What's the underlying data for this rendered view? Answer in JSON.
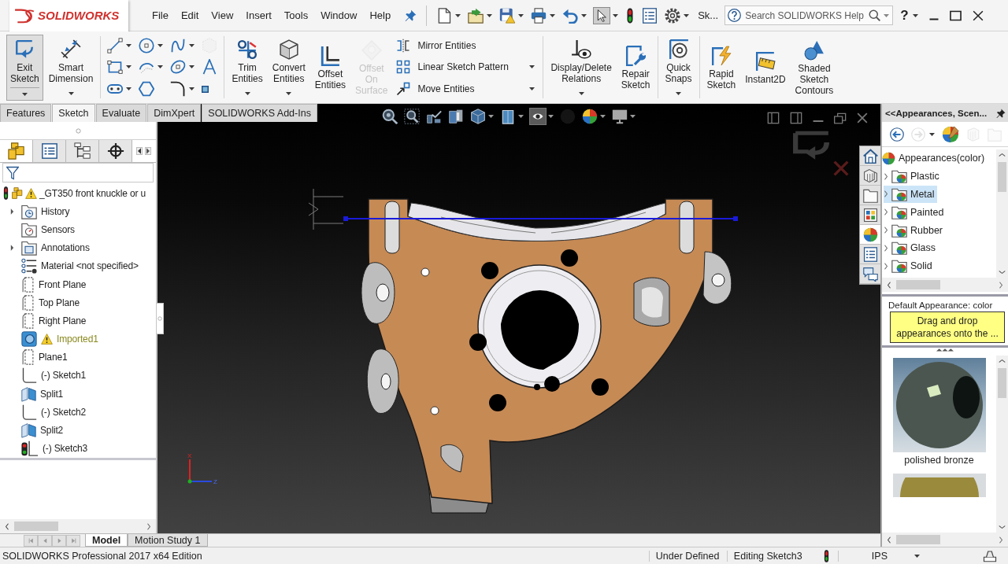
{
  "logo": {
    "text": "SOLIDWORKS"
  },
  "menu": [
    "File",
    "Edit",
    "View",
    "Insert",
    "Tools",
    "Window",
    "Help"
  ],
  "quick_access": [
    {
      "dropdown": true,
      "selected": false
    },
    {
      "dropdown": true,
      "selected": false
    },
    {
      "dropdown": true,
      "selected": false
    },
    {
      "dropdown": true,
      "selected": false
    },
    {
      "dropdown": true,
      "selected": false
    },
    {
      "dropdown": true,
      "selected": true
    },
    {
      "dropdown": false,
      "selected": false
    },
    {
      "dropdown": false,
      "selected": false
    },
    {
      "dropdown": true,
      "selected": false
    }
  ],
  "document_label": "Sk...",
  "search": {
    "placeholder": "Search SOLIDWORKS Help"
  },
  "help_button": "?",
  "ribbon": {
    "groups": [
      {
        "items": [
          {
            "kind": "button",
            "label": "Exit Sketch",
            "dropdown": true,
            "pressed": true,
            "disabled": false
          },
          {
            "kind": "button",
            "label": "Smart Dimension",
            "dropdown": true,
            "pressed": false,
            "disabled": false
          }
        ]
      },
      {
        "items": [
          {
            "kind": "tools",
            "tools": [
              {
                "dropdown": true,
                "disabled": false
              },
              {
                "dropdown": true,
                "disabled": false
              },
              {
                "dropdown": true,
                "disabled": false
              },
              {
                "dropdown": false,
                "disabled": true
              },
              {
                "dropdown": true,
                "disabled": false
              },
              {
                "dropdown": true,
                "disabled": false
              },
              {
                "dropdown": true,
                "disabled": false
              },
              {
                "dropdown": false,
                "disabled": false
              },
              {
                "dropdown": true,
                "disabled": false
              },
              {
                "dropdown": false,
                "disabled": false
              },
              {
                "dropdown": true,
                "disabled": false
              },
              {
                "dropdown": false,
                "disabled": false
              }
            ]
          }
        ]
      },
      {
        "items": [
          {
            "kind": "button",
            "label": "Trim Entities",
            "dropdown": true,
            "pressed": false,
            "disabled": false
          },
          {
            "kind": "button",
            "label": "Convert Entities",
            "dropdown": true,
            "pressed": false,
            "disabled": false
          },
          {
            "kind": "button",
            "label": "Offset Entities",
            "dropdown": false,
            "pressed": false,
            "disabled": false
          },
          {
            "kind": "button",
            "label": "Offset On Surface",
            "dropdown": false,
            "pressed": false,
            "disabled": true
          },
          {
            "kind": "list",
            "entries": [
              {
                "label": "Mirror Entities",
                "dropdown": false
              },
              {
                "label": "Linear Sketch Pattern",
                "dropdown": true
              },
              {
                "label": "Move Entities",
                "dropdown": true
              }
            ]
          }
        ]
      },
      {
        "items": [
          {
            "kind": "button",
            "label": "Display/Delete Relations",
            "dropdown": true,
            "pressed": false,
            "disabled": false
          },
          {
            "kind": "button",
            "label": "Repair Sketch",
            "dropdown": false,
            "pressed": false,
            "disabled": false
          }
        ]
      },
      {
        "items": [
          {
            "kind": "button",
            "label": "Quick Snaps",
            "dropdown": true,
            "pressed": false,
            "disabled": false
          }
        ]
      },
      {
        "items": [
          {
            "kind": "button",
            "label": "Rapid Sketch",
            "dropdown": false,
            "pressed": false,
            "disabled": false
          },
          {
            "kind": "button",
            "label": "Instant2D",
            "dropdown": false,
            "pressed": false,
            "disabled": false
          },
          {
            "kind": "button",
            "label": "Shaded Sketch Contours",
            "dropdown": false,
            "pressed": false,
            "disabled": false
          }
        ]
      }
    ]
  },
  "command_tabs": [
    {
      "label": "Features",
      "selected": false
    },
    {
      "label": "Sketch",
      "selected": true
    },
    {
      "label": "Evaluate",
      "selected": false
    },
    {
      "label": "DimXpert",
      "selected": false
    },
    {
      "label": "SOLIDWORKS Add-Ins",
      "selected": false
    }
  ],
  "feature_manager": {
    "tabs": [
      {
        "selected": true
      },
      {
        "selected": false
      },
      {
        "selected": false
      },
      {
        "selected": false
      }
    ],
    "tree": [
      {
        "label": "_GT350 front knuckle or u",
        "kind": "part",
        "warning": true,
        "highlighted": false,
        "collapsed": false,
        "children": [
          {
            "label": "History",
            "kind": "history",
            "warning": false,
            "highlighted": false,
            "collapsed": true
          },
          {
            "label": "Sensors",
            "kind": "sensors",
            "warning": false,
            "highlighted": false,
            "collapsed": false
          },
          {
            "label": "Annotations",
            "kind": "annotations",
            "warning": false,
            "highlighted": false,
            "collapsed": true
          },
          {
            "label": "Material <not specified>",
            "kind": "material",
            "warning": false,
            "highlighted": false,
            "collapsed": false
          },
          {
            "label": "Front Plane",
            "kind": "plane",
            "warning": false,
            "highlighted": false,
            "collapsed": false
          },
          {
            "label": "Top Plane",
            "kind": "plane",
            "warning": false,
            "highlighted": false,
            "collapsed": false
          },
          {
            "label": "Right Plane",
            "kind": "plane",
            "warning": false,
            "highlighted": false,
            "collapsed": false
          },
          {
            "label": "Imported1",
            "kind": "body",
            "warning": true,
            "highlighted": true,
            "collapsed": false
          },
          {
            "label": "Plane1",
            "kind": "plane",
            "warning": false,
            "highlighted": false,
            "collapsed": false
          },
          {
            "label": "(-) Sketch1",
            "kind": "sketch",
            "warning": false,
            "highlighted": false,
            "collapsed": false
          },
          {
            "label": "Split1",
            "kind": "split",
            "warning": false,
            "highlighted": false,
            "collapsed": false
          },
          {
            "label": "(-) Sketch2",
            "kind": "sketch",
            "warning": false,
            "highlighted": false,
            "collapsed": false
          },
          {
            "label": "Split2",
            "kind": "split",
            "warning": false,
            "highlighted": false,
            "collapsed": false
          },
          {
            "label": "(-) Sketch3",
            "kind": "editing",
            "warning": false,
            "highlighted": false,
            "collapsed": false
          }
        ]
      }
    ]
  },
  "viewport": {
    "heads_up": [
      {
        "dropdown": false,
        "selected": false,
        "disabled": false
      },
      {
        "dropdown": false,
        "selected": false,
        "disabled": false
      },
      {
        "dropdown": false,
        "selected": false,
        "disabled": false
      },
      {
        "dropdown": false,
        "selected": false,
        "disabled": false
      },
      {
        "dropdown": true,
        "selected": false,
        "disabled": false
      },
      {
        "dropdown": true,
        "selected": false,
        "disabled": false
      },
      {
        "dropdown": true,
        "selected": true,
        "disabled": false
      },
      {
        "dropdown": false,
        "selected": false,
        "disabled": true
      },
      {
        "dropdown": true,
        "selected": false,
        "disabled": false
      },
      {
        "dropdown": true,
        "selected": false,
        "disabled": false
      }
    ],
    "triad": {
      "labels": [
        "X",
        "Z"
      ]
    }
  },
  "task_pane": [
    {
      "selected": false
    },
    {
      "selected": false
    },
    {
      "selected": false
    },
    {
      "selected": false
    },
    {
      "selected": true
    },
    {
      "selected": false
    },
    {
      "selected": false
    }
  ],
  "appearances": {
    "title": "<<Appearances, Scen...",
    "toolbar": [
      {
        "disabled": false,
        "dropdown": false
      },
      {
        "disabled": true,
        "dropdown": true
      },
      {
        "disabled": false,
        "dropdown": false
      },
      {
        "disabled": true,
        "dropdown": false
      },
      {
        "disabled": true,
        "dropdown": false
      }
    ],
    "tree": [
      {
        "label": "Appearances(color)",
        "selected": false,
        "collapsed": false,
        "children": [
          {
            "label": "Plastic",
            "selected": false,
            "collapsed": true
          },
          {
            "label": "Metal",
            "selected": true,
            "collapsed": true
          },
          {
            "label": "Painted",
            "selected": false,
            "collapsed": true
          },
          {
            "label": "Rubber",
            "selected": false,
            "collapsed": true
          },
          {
            "label": "Glass",
            "selected": false,
            "collapsed": true
          },
          {
            "label": "Solid",
            "selected": false,
            "collapsed": true
          }
        ]
      }
    ],
    "default_label": "Default Appearance: color",
    "hint": "Drag and drop appearances onto the ...",
    "swatches": [
      {
        "label": "polished bronze",
        "color": "#4b5650"
      },
      {
        "color": "#9a8a3c"
      }
    ]
  },
  "bottom_tabs": [
    {
      "label": "Model",
      "selected": true
    },
    {
      "label": "Motion Study 1",
      "selected": false
    }
  ],
  "status_bar": {
    "edition": "SOLIDWORKS Professional 2017 x64 Edition",
    "sketch_state": "Under Defined",
    "editing": "Editing Sketch3",
    "units": "IPS"
  }
}
